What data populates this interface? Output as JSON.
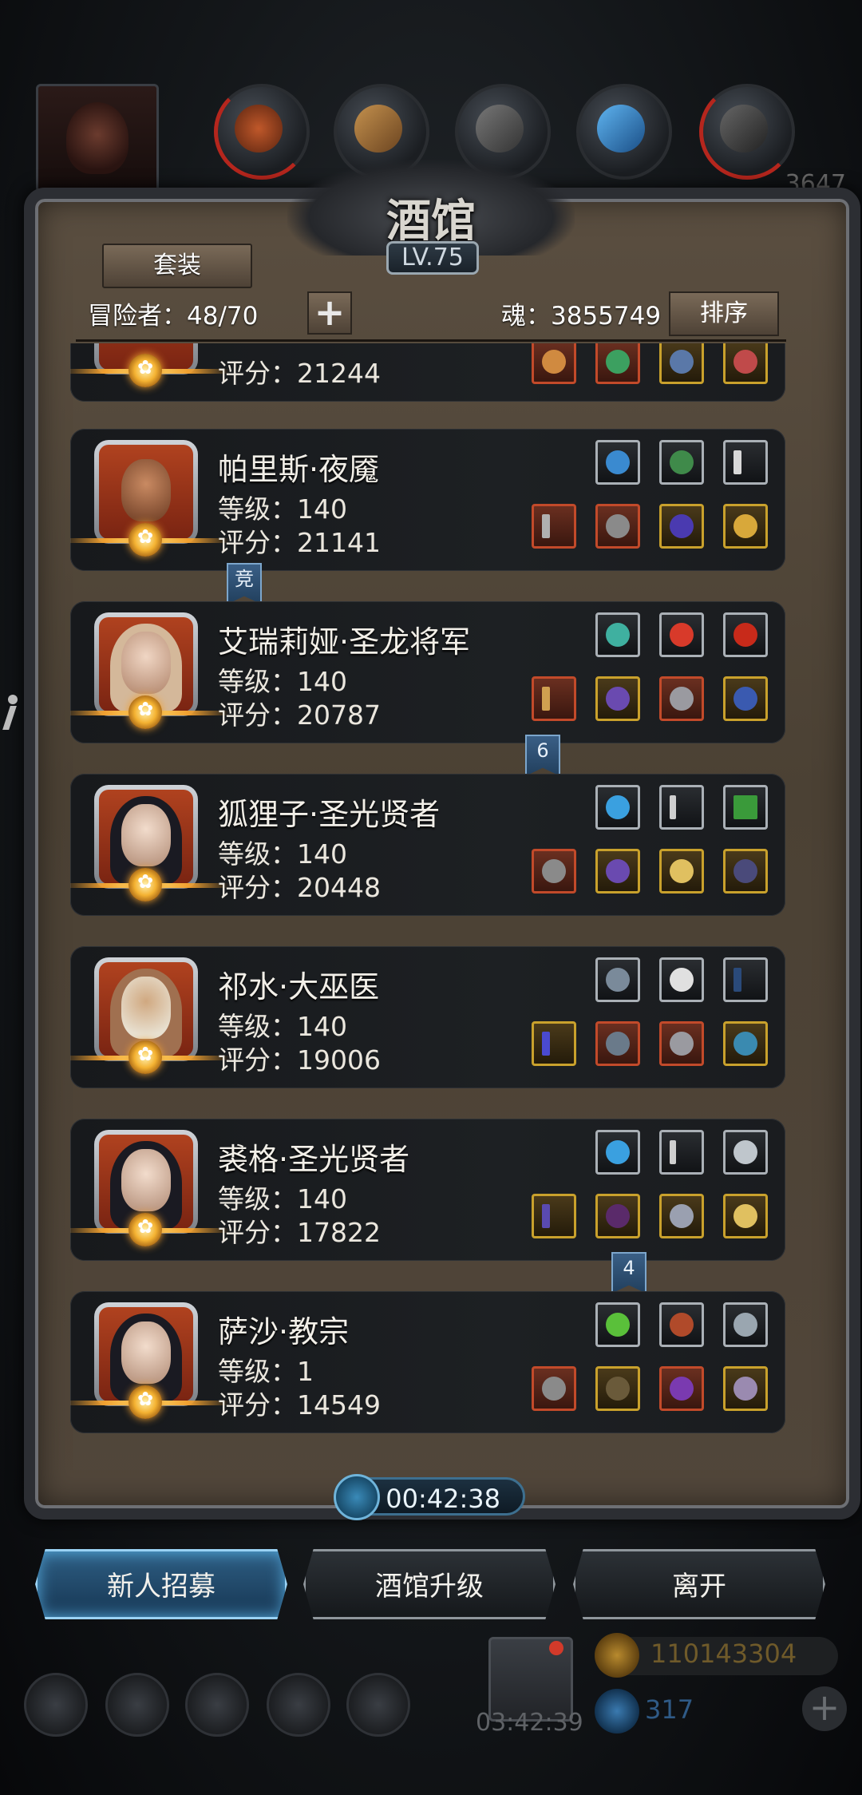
{
  "header": {
    "title": "酒馆",
    "level": "LV.75",
    "set_button": "套装",
    "adventurers_label": "冒险者：48/70",
    "plus_button": "+",
    "soul_label": "魂：3855749",
    "sort_button": "排序"
  },
  "background_top_number": "3647",
  "heroes": [
    {
      "name": "",
      "level": "",
      "score": "评分：21244",
      "upper_slots": [],
      "lower_slots": [
        "red",
        "red",
        "gold",
        "gold"
      ]
    },
    {
      "name": "帕里斯·夜魇",
      "level": "等级：140",
      "score": "评分：21141",
      "upper_slots": [
        "plain",
        "plain",
        "plain"
      ],
      "lower_slots": [
        "red",
        "red",
        "gold",
        "gold"
      ]
    },
    {
      "name": "艾瑞莉娅·圣龙将军",
      "level": "等级：140",
      "score": "评分：20787",
      "upper_slots": [
        "plain",
        "plain",
        "plain"
      ],
      "lower_slots": [
        "red",
        "gold",
        "red",
        "gold"
      ]
    },
    {
      "name": "狐狸子·圣光贤者",
      "level": "等级：140",
      "score": "评分：20448",
      "upper_slots": [
        "plain",
        "plain",
        "plain"
      ],
      "lower_slots": [
        "red",
        "gold",
        "gold",
        "gold"
      ]
    },
    {
      "name": "祁水·大巫医",
      "level": "等级：140",
      "score": "评分：19006",
      "upper_slots": [
        "plain",
        "plain",
        "plain"
      ],
      "lower_slots": [
        "gold",
        "red",
        "red",
        "gold"
      ]
    },
    {
      "name": "裘格·圣光贤者",
      "level": "等级：140",
      "score": "评分：17822",
      "upper_slots": [
        "plain",
        "plain",
        "plain"
      ],
      "lower_slots": [
        "gold",
        "gold",
        "gold",
        "gold"
      ]
    },
    {
      "name": "萨沙·教宗",
      "level": "等级：1",
      "score": "评分：14549",
      "upper_slots": [
        "plain",
        "plain",
        "plain"
      ],
      "lower_slots": [
        "red",
        "gold",
        "red",
        "gold"
      ]
    }
  ],
  "tags": {
    "arena": "竞",
    "team6": "6",
    "team4": "4"
  },
  "timer": "00:42:38",
  "buttons": {
    "recruit": "新人招募",
    "upgrade": "酒馆升级",
    "leave": "离开"
  },
  "hud": {
    "gift_timer": "03:42:39",
    "gold": "110143304",
    "gems": "317",
    "plus": "+"
  },
  "colors": {
    "accent_blue": "#2d5d82",
    "emblem_gold": "#f4b232",
    "slot_red": "#c24a2a",
    "slot_gold": "#c9a12c"
  }
}
